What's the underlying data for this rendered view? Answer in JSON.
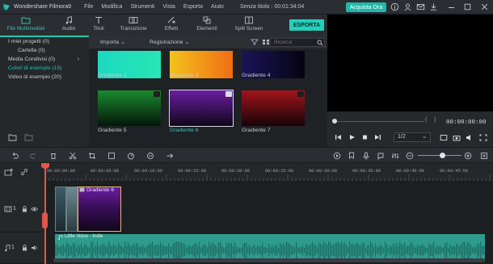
{
  "titlebar": {
    "app_title": "Wondershare Filmora9",
    "menu": [
      "File",
      "Modifica",
      "Strumenti",
      "Vista",
      "Esporta",
      "Aiuto"
    ],
    "project": "Senza titolo : 00:01:34:04",
    "buy_label": "Acquista Ora",
    "icons": [
      "info-icon",
      "user-icon",
      "mail-icon",
      "download-icon",
      "minimize-icon",
      "maximize-icon",
      "close-icon"
    ]
  },
  "tabs": [
    {
      "label": "File Multimediali",
      "icon": "folder-icon",
      "active": true
    },
    {
      "label": "Audio",
      "icon": "music-note-icon",
      "active": false
    },
    {
      "label": "Titoli",
      "icon": "text-icon",
      "active": false
    },
    {
      "label": "Transizione",
      "icon": "transition-icon",
      "active": false
    },
    {
      "label": "Effetti",
      "icon": "effects-icon",
      "active": false
    },
    {
      "label": "Elementi",
      "icon": "elements-icon",
      "active": false
    },
    {
      "label": "Split Screen",
      "icon": "split-screen-icon",
      "active": false
    }
  ],
  "export_label": "ESPORTA",
  "library": {
    "items": [
      {
        "label": "I miei progetti (0)",
        "sub": false,
        "active": false
      },
      {
        "label": "Cartella (0)",
        "sub": true,
        "active": false
      },
      {
        "label": "Media Condivisi (0)",
        "sub": false,
        "active": false,
        "arrow": "›"
      },
      {
        "label": "Colori di esempio (15)",
        "sub": false,
        "active": true
      },
      {
        "label": "Video di esempio (20)",
        "sub": false,
        "active": false
      }
    ]
  },
  "media_header": {
    "import_label": "Importa",
    "record_label": "Registrazione",
    "search_placeholder": "Ricerca"
  },
  "media": [
    {
      "label": "Gradiente 2",
      "colors": [
        "#1bd9c0",
        "#28e6b4"
      ],
      "selected": false,
      "badge": false
    },
    {
      "label": "Gradiente 3",
      "colors": [
        "#f2c21a",
        "#f06d16"
      ],
      "selected": false,
      "badge": false
    },
    {
      "label": "Gradiente 4",
      "colors": [
        "#1b1457",
        "#060312"
      ],
      "selected": false,
      "badge": false
    },
    {
      "label": "Gradiente 5",
      "colors": [
        "#1a8a2f",
        "#04160a"
      ],
      "selected": false,
      "badge": true
    },
    {
      "label": "Gradiente 6",
      "colors": [
        "#6a1ea0",
        "#10061b"
      ],
      "selected": true,
      "badge": true
    },
    {
      "label": "Gradiente 7",
      "colors": [
        "#a3141c",
        "#160406"
      ],
      "selected": false,
      "badge": true
    }
  ],
  "preview": {
    "time": "00:00:00:00",
    "ratio": "1/2",
    "playback_icons": [
      "prev-frame-icon",
      "play-icon",
      "stop-icon",
      "next-frame-icon"
    ]
  },
  "ruler": {
    "labels": [
      "00:00:00:00",
      "00:00:05:00",
      "00:00:10:00",
      "00:00:15:00",
      "00:00:20:00",
      "00:00:25:00",
      "00:00:30:00",
      "00:00:35:00",
      "00:00:40:00",
      "00:00:45:00"
    ]
  },
  "tracks": {
    "video_label": "1",
    "audio_label": "1",
    "clip_title": "Gradiente 6",
    "audio_clip_title": "Little Voice - Indie"
  },
  "colors": {
    "accent": "#22d1bc",
    "playhead": "#e8554c",
    "audio_clip": "#2e9c8d"
  }
}
